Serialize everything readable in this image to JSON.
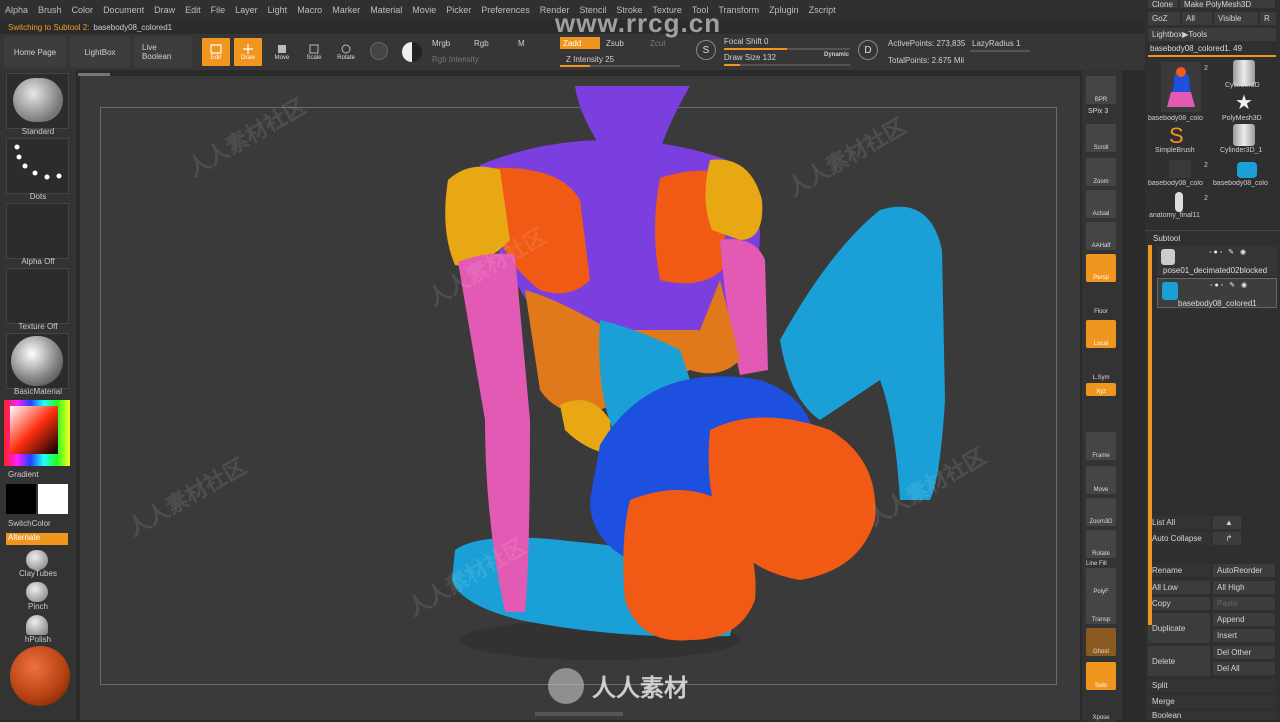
{
  "menu": [
    "Alpha",
    "Brush",
    "Color",
    "Document",
    "Draw",
    "Edit",
    "File",
    "Layer",
    "Light",
    "Macro",
    "Marker",
    "Material",
    "Movie",
    "Picker",
    "Preferences",
    "Render",
    "Stencil",
    "Stroke",
    "Texture",
    "Tool",
    "Transform",
    "Zplugin",
    "Zscript"
  ],
  "info": {
    "prefix": "Switching to Subtool 2:",
    "name": "basebody08_colored1"
  },
  "toolbar": {
    "home": "Home Page",
    "lightbox": "LightBox",
    "live_boolean": "Live Boolean",
    "edit": "Edit",
    "draw": "Draw",
    "move": "Move",
    "scale": "Scale",
    "rotate": "Rotate",
    "mrgb": "Mrgb",
    "rgb": "Rgb",
    "m": "M",
    "rgb_intensity": "Rgb Intensity",
    "zadd": "Zadd",
    "zsub": "Zsub",
    "zcut": "Zcut",
    "z_intensity": "Z Intensity 25",
    "focal_shift": "Focal Shift 0",
    "draw_size": "Draw Size 132",
    "dynamic": "Dynamic",
    "active_points": "ActivePoints: 273,835",
    "lazy_radius": "LazyRadius 1",
    "total_points": "TotalPoints: 2.675 Mil",
    "z_intensity_value": 0.25,
    "draw_size_value": 0.13,
    "focal_shift_value": 0.5
  },
  "left": {
    "standard": "Standard",
    "dots": "Dots",
    "alpha_off": "Alpha Off",
    "texture_off": "Texture Off",
    "material": "BasicMaterial",
    "gradient": "Gradient",
    "switch_color": "SwitchColor",
    "alternate": "Alternate",
    "claytubes": "ClayTubes",
    "pinch": "Pinch",
    "hpolish": "hPolish"
  },
  "right_shelf": {
    "bpr": "BPR",
    "spix": "SPix 3",
    "scroll": "Scroll",
    "zoom": "Zoom",
    "actual": "Actual",
    "aahalf": "AAHalf",
    "persp": "Persp",
    "floor": "Floor",
    "local": "Local",
    "lsym": "L.Sym",
    "xyz": "Xyz",
    "frame": "Frame",
    "move": "Move",
    "zoom3d": "Zoom3D",
    "rotate": "Rotate",
    "linefill": "Line Fill",
    "polyf": "PolyF",
    "transp": "Transp",
    "ghost": "Ghost",
    "solo": "Solo",
    "xpose": "Xpose"
  },
  "tray": {
    "clone": "Clone",
    "make_polymesh": "Make PolyMesh3D",
    "goz": "GoZ",
    "all": "All",
    "visible": "Visible",
    "r": "R",
    "lightbox_tools": "Lightbox▶Tools",
    "current_tool": "basebody08_colored1. 49",
    "tools": [
      {
        "label": "basebody08_colo",
        "count": "2"
      },
      {
        "label": "Cylinder3D",
        "count": ""
      },
      {
        "label": "PolyMesh3D",
        "count": ""
      },
      {
        "label": "SimpleBrush",
        "count": ""
      },
      {
        "label": "Cylinder3D_1",
        "count": ""
      },
      {
        "label": "basebody08_colo",
        "count": "2"
      },
      {
        "label": "basebody08_colo",
        "count": ""
      },
      {
        "label": "anatomy_final11",
        "count": "2"
      }
    ],
    "subtool": "Subtool",
    "subtools": [
      "pose01_decimated02blocked",
      "basebody08_colored1"
    ],
    "list_all": "List All",
    "auto_collapse": "Auto Collapse",
    "rename": "Rename",
    "auto_reorder": "AutoReorder",
    "all_low": "All Low",
    "all_high": "All High",
    "copy": "Copy",
    "paste": "Paste",
    "append": "Append",
    "duplicate": "Duplicate",
    "insert": "Insert",
    "delete": "Delete",
    "del_other": "Del Other",
    "del_all": "Del All",
    "split": "Split",
    "merge": "Merge",
    "boolean": "Boolean"
  },
  "watermark": {
    "site": "www.rrcg.cn",
    "brand": "人人素材",
    "tile": "人人素材社区"
  },
  "colors": {
    "accent": "#f0961e",
    "purple": "#7b3fe0",
    "orange": "#f05a14",
    "yellow": "#e8a814",
    "pink": "#e25ab4",
    "cyan": "#1aa0d6",
    "blue": "#1e50e0"
  }
}
